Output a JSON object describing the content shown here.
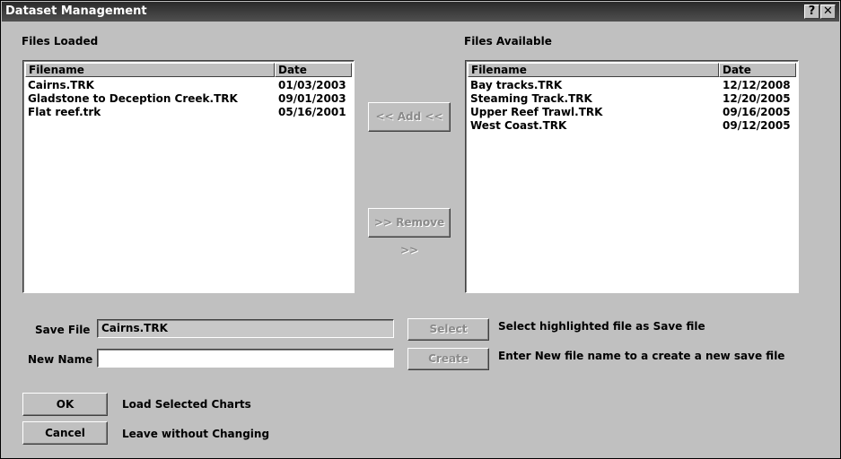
{
  "window": {
    "title": "Dataset Management",
    "help_glyph": "?",
    "close_glyph": "✕"
  },
  "loaded": {
    "heading": "Files Loaded",
    "col_filename": "Filename",
    "col_date": "Date",
    "rows": [
      {
        "name": "Cairns.TRK",
        "date": "01/03/2003"
      },
      {
        "name": "Gladstone to Deception Creek.TRK",
        "date": "09/01/2003"
      },
      {
        "name": "Flat reef.trk",
        "date": "05/16/2001"
      }
    ]
  },
  "available": {
    "heading": "Files Available",
    "col_filename": "Filename",
    "col_date": "Date",
    "rows": [
      {
        "name": "Bay tracks.TRK",
        "date": "12/12/2008"
      },
      {
        "name": "Steaming Track.TRK",
        "date": "12/20/2005"
      },
      {
        "name": "Upper Reef Trawl.TRK",
        "date": "09/16/2005"
      },
      {
        "name": "West Coast.TRK",
        "date": "09/12/2005"
      }
    ]
  },
  "actions": {
    "add_label": "<< Add <<",
    "remove_label": ">> Remove >>"
  },
  "save": {
    "save_file_label": "Save File",
    "save_file_value": "Cairns.TRK",
    "select_label": "Select",
    "select_desc": "Select highlighted file as Save file",
    "new_name_label": "New Name",
    "new_name_value": "",
    "create_label": "Create",
    "create_desc": "Enter New file name to a create a new save file"
  },
  "footer": {
    "ok_label": "OK",
    "ok_desc": "Load Selected Charts",
    "cancel_label": "Cancel",
    "cancel_desc": "Leave without Changing"
  }
}
